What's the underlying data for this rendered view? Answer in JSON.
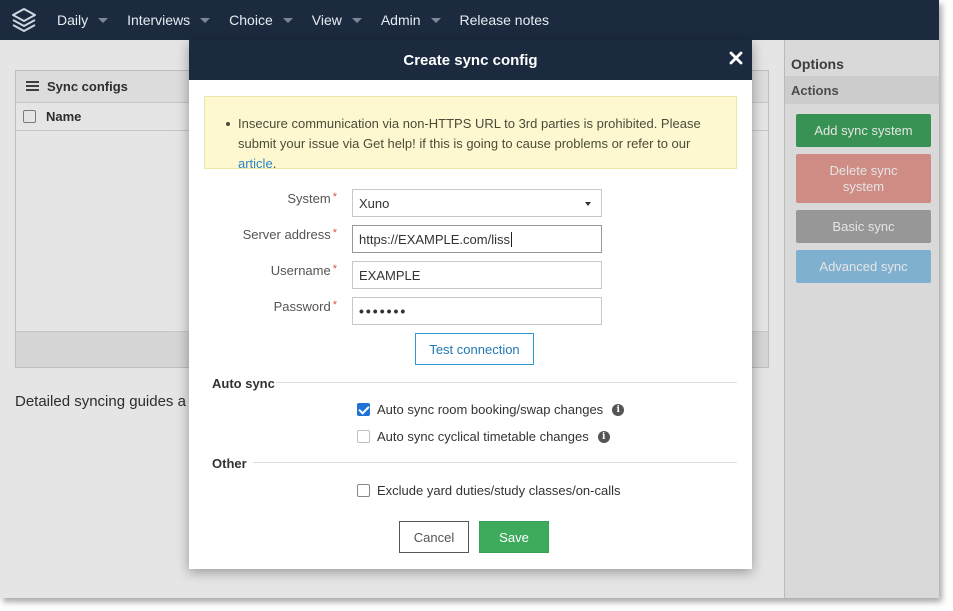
{
  "nav": {
    "logo": "layers-logo",
    "items": [
      {
        "label": "Daily",
        "dropdown": true
      },
      {
        "label": "Interviews",
        "dropdown": true
      },
      {
        "label": "Choice",
        "dropdown": true
      },
      {
        "label": "View",
        "dropdown": true
      },
      {
        "label": "Admin",
        "dropdown": true
      },
      {
        "label": "Release notes",
        "dropdown": false
      }
    ]
  },
  "background": {
    "panel_title": "Sync configs",
    "column_name": "Name",
    "guide_text": "Detailed syncing guides a"
  },
  "sidebar": {
    "title": "Options",
    "subtitle": "Actions",
    "buttons": [
      {
        "label": "Add sync system",
        "color": "#3ea35d"
      },
      {
        "label": "Delete sync system",
        "color": "#e69c93"
      },
      {
        "label": "Basic sync",
        "color": "#a9a9a9"
      },
      {
        "label": "Advanced sync",
        "color": "#8ec5e8"
      }
    ]
  },
  "modal": {
    "title": "Create sync config",
    "alert": {
      "text": "Insecure communication via non-HTTPS URL to 3rd parties is prohibited. Please submit your issue via Get help! if this is going to cause problems or refer to our ",
      "link": "article",
      "suffix": "."
    },
    "fields": {
      "system": {
        "label": "System",
        "required": "*",
        "value": "Xuno"
      },
      "server": {
        "label": "Server address",
        "required": "*",
        "value": "https://EXAMPLE.com/liss"
      },
      "username": {
        "label": "Username",
        "required": "*",
        "value": "EXAMPLE"
      },
      "password": {
        "label": "Password",
        "required": "*",
        "value": "•••••••"
      }
    },
    "test_button": "Test connection",
    "auto_sync": {
      "title": "Auto sync",
      "options": [
        {
          "label": "Auto sync room booking/swap changes",
          "checked": true,
          "disabled": false
        },
        {
          "label": "Auto sync cyclical timetable changes",
          "checked": false,
          "disabled": true
        }
      ]
    },
    "other": {
      "title": "Other",
      "options": [
        {
          "label": "Exclude yard duties/study classes/on-calls",
          "checked": false
        }
      ]
    },
    "cancel_label": "Cancel",
    "save_label": "Save"
  },
  "colors": {
    "navbar": "#1b2a3f",
    "primary_green": "#3daa5c",
    "link_blue": "#2b85c7",
    "alert_bg": "#fdf8cf"
  }
}
